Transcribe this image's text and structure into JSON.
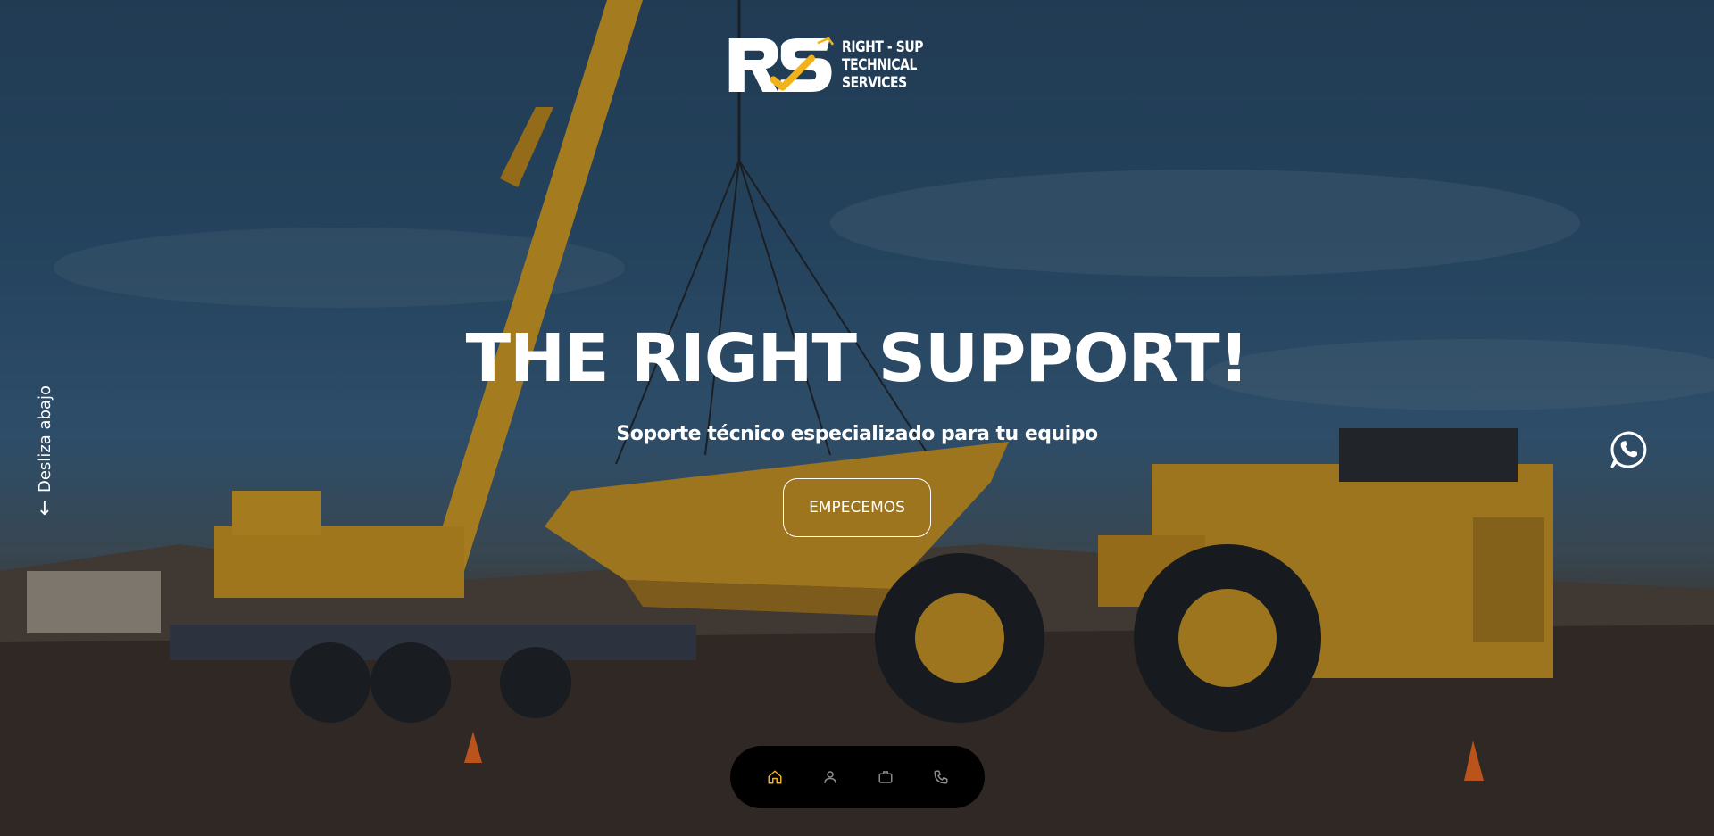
{
  "brand": {
    "line1": "RIGHT - SUP",
    "line2": "TECHNICAL SERVICES",
    "logo_letters": "RS",
    "accent_color": "#f2b31a"
  },
  "hero": {
    "title": "THE RIGHT SUPPORT!",
    "subtitle": "Soporte técnico especializado para tu equipo",
    "cta_label": "EMPECEMOS"
  },
  "scroll_hint": {
    "label": "Desliza abajo",
    "arrow": "↓"
  },
  "floating": {
    "whatsapp_icon": "whatsapp-icon"
  },
  "bottom_nav": {
    "items": [
      {
        "icon": "home-icon",
        "active": true
      },
      {
        "icon": "user-icon",
        "active": false
      },
      {
        "icon": "briefcase-icon",
        "active": false
      },
      {
        "icon": "phone-icon",
        "active": false
      }
    ],
    "active_color": "#f2b31a",
    "inactive_color": "#8c8c8c"
  }
}
